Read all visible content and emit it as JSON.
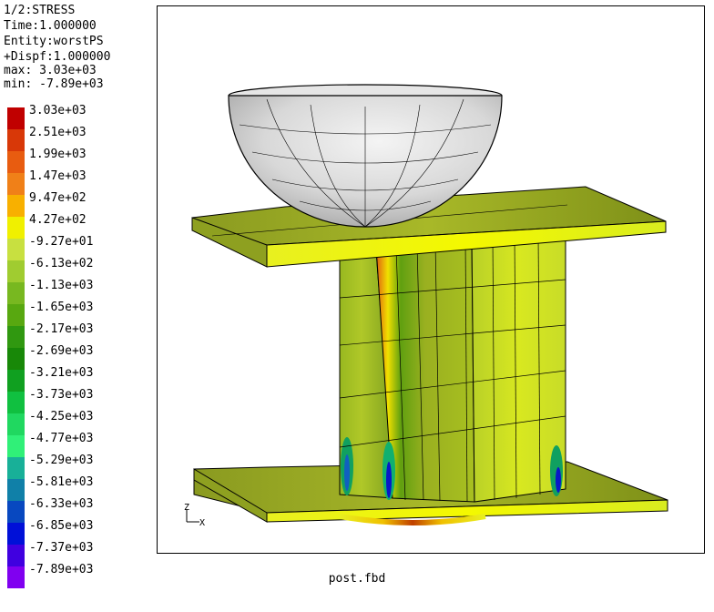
{
  "header": {
    "step_title": "1/2:STRESS",
    "time": "Time:1.000000",
    "entity": "Entity:worstPS",
    "dispf": "+Dispf:1.000000",
    "max": "max: 3.03e+03",
    "min": "min: -7.89e+03"
  },
  "legend": {
    "entries": [
      {
        "label": "3.03e+03",
        "color": "#c00000"
      },
      {
        "label": "2.51e+03",
        "color": "#d83808"
      },
      {
        "label": "1.99e+03",
        "color": "#e85c10"
      },
      {
        "label": "1.47e+03",
        "color": "#f08018"
      },
      {
        "label": "9.47e+02",
        "color": "#f8b000"
      },
      {
        "label": "4.27e+02",
        "color": "#f0f000"
      },
      {
        "label": "-9.27e+01",
        "color": "#c8e040"
      },
      {
        "label": "-6.13e+02",
        "color": "#a0cc30"
      },
      {
        "label": "-1.13e+03",
        "color": "#78b820"
      },
      {
        "label": "-1.65e+03",
        "color": "#58a810"
      },
      {
        "label": "-2.17e+03",
        "color": "#309810"
      },
      {
        "label": "-2.69e+03",
        "color": "#188808"
      },
      {
        "label": "-3.21e+03",
        "color": "#10a020"
      },
      {
        "label": "-3.73e+03",
        "color": "#10c040"
      },
      {
        "label": "-4.25e+03",
        "color": "#20d860"
      },
      {
        "label": "-4.77e+03",
        "color": "#30f078"
      },
      {
        "label": "-5.29e+03",
        "color": "#18b098"
      },
      {
        "label": "-5.81e+03",
        "color": "#1080a8"
      },
      {
        "label": "-6.33e+03",
        "color": "#0848c0"
      },
      {
        "label": "-6.85e+03",
        "color": "#0010d8"
      },
      {
        "label": "-7.37e+03",
        "color": "#4000e0"
      },
      {
        "label": "-7.89e+03",
        "color": "#8000f0"
      }
    ]
  },
  "axis_triad": {
    "z": "Z",
    "x": "X"
  },
  "footer": {
    "filename": "post.fbd"
  }
}
